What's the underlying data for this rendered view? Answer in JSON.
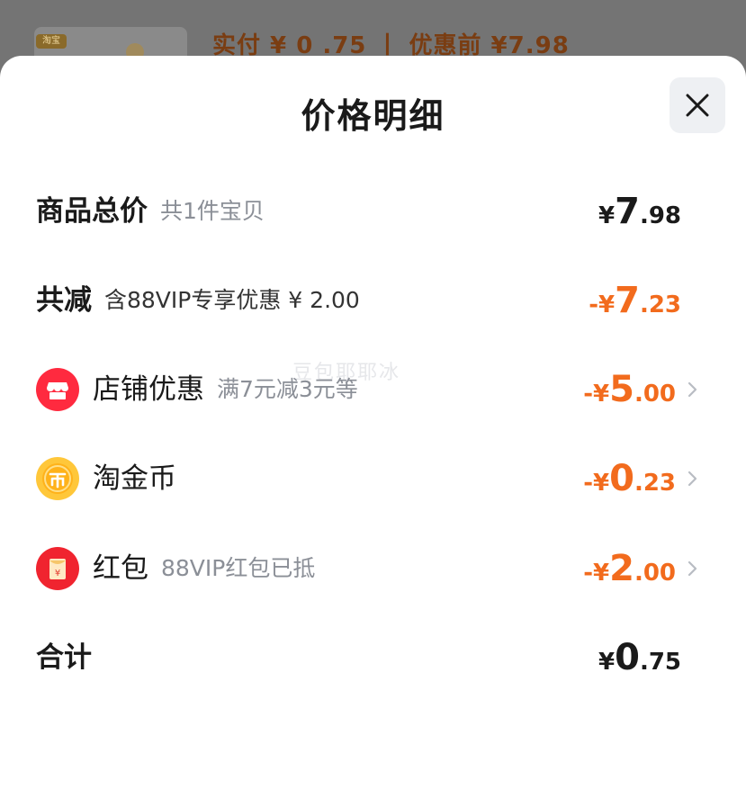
{
  "backdrop": {
    "thumb_tag": "淘宝",
    "summary": "实付 ¥ 0 .75 丨 优惠前 ¥7.98"
  },
  "sheet": {
    "title": "价格明细",
    "close_icon": "close-icon"
  },
  "rows": [
    {
      "label": "商品总价",
      "sub": "共1件宝贝",
      "amount": {
        "currency": "¥",
        "int": "7",
        "dec": ".98"
      },
      "negative": false
    },
    {
      "label": "共减",
      "sub": "含88VIP专享优惠 ¥ 2.00",
      "amount": {
        "currency": "-¥",
        "int": "7",
        "dec": ".23"
      },
      "negative": true
    },
    {
      "icon": "shop-icon",
      "label": "店铺优惠",
      "sub": "满7元减3元等",
      "amount": {
        "currency": "-¥",
        "int": "5",
        "dec": ".00"
      },
      "negative": true,
      "chevron": "chevron-right-icon"
    },
    {
      "icon": "taojinbi-coin-icon",
      "label": "淘金币",
      "sub": "",
      "amount": {
        "currency": "-¥",
        "int": "0",
        "dec": ".23"
      },
      "negative": true,
      "chevron": "chevron-right-icon"
    },
    {
      "icon": "red-packet-icon",
      "label": "红包",
      "sub": "88VIP红包已抵",
      "amount": {
        "currency": "-¥",
        "int": "2",
        "dec": ".00"
      },
      "negative": true,
      "chevron": "chevron-right-icon"
    },
    {
      "label": "合计",
      "sub": "",
      "amount": {
        "currency": "¥",
        "int": "0",
        "dec": ".75"
      },
      "negative": false
    }
  ],
  "watermark": "豆包耶耶冰",
  "colors": {
    "accent_orange": "#f26b1d",
    "text_primary": "#1a1a1a",
    "text_secondary": "#8b8f97",
    "shop_red": "#ff2a3f",
    "coin_gold": "#ffc73a"
  }
}
